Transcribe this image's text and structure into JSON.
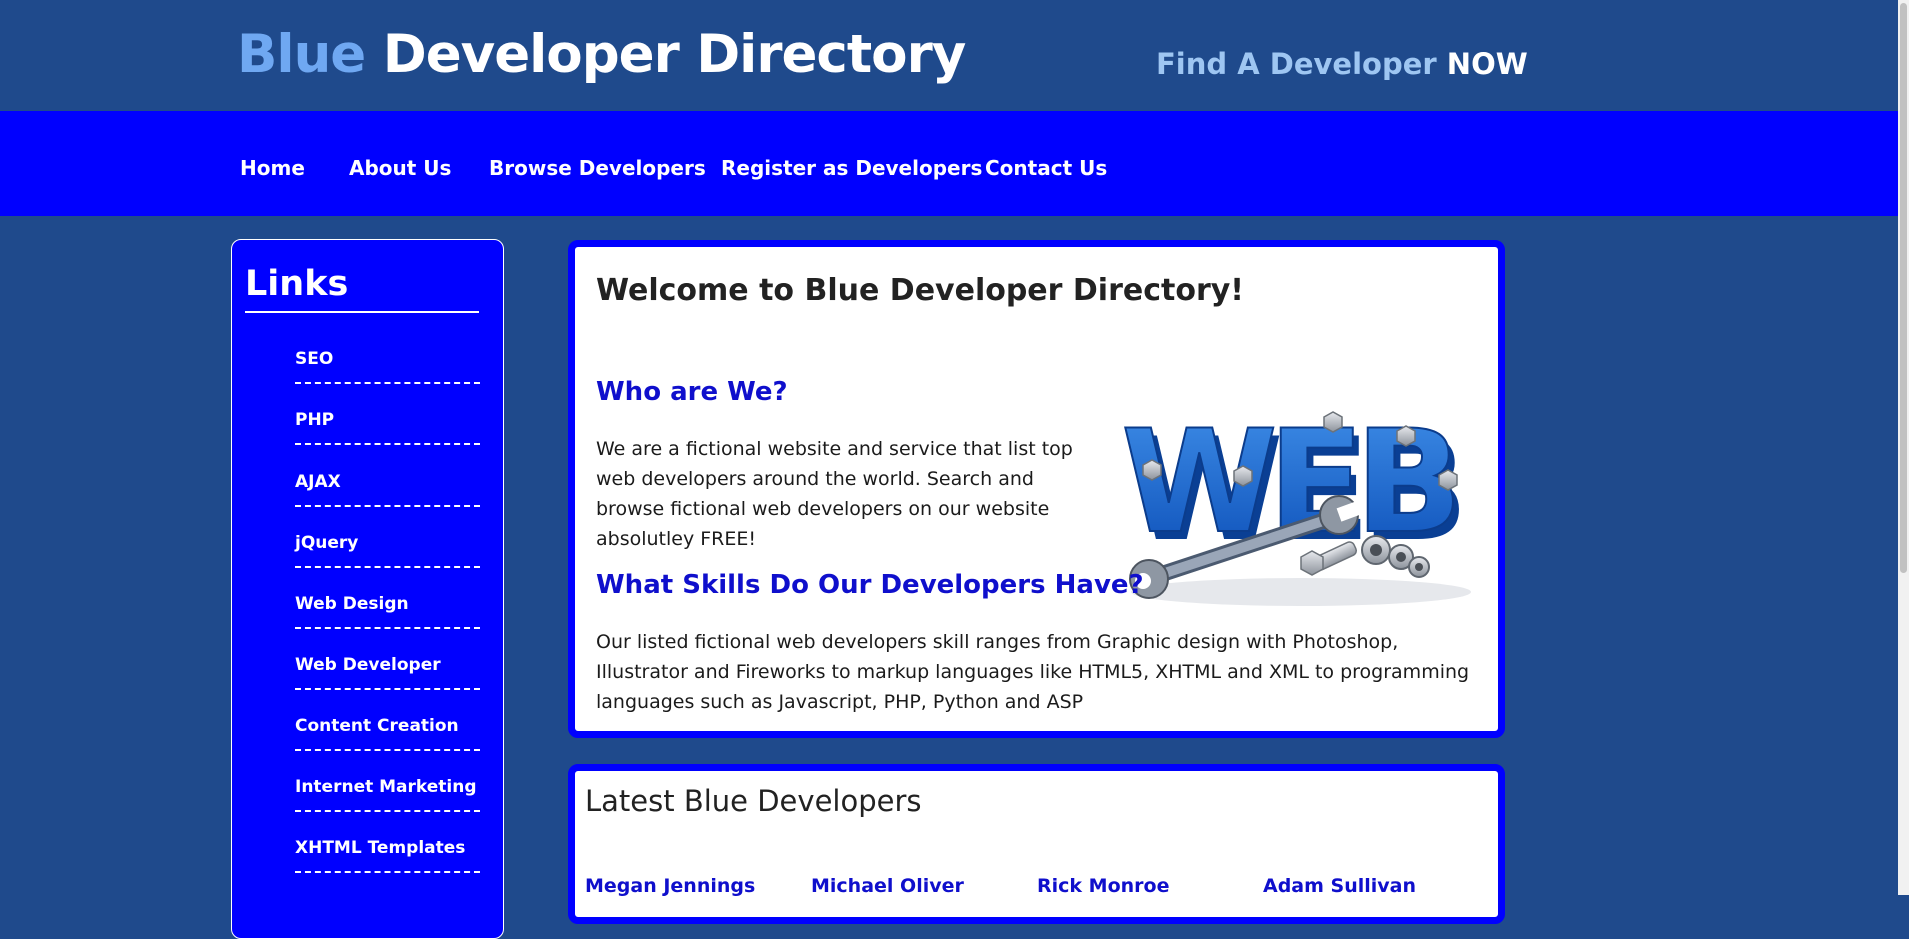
{
  "header": {
    "title_accent": "Blue",
    "title_rest": " Developer Directory",
    "tagline_main": "Find A Developer ",
    "tagline_strong": "NOW"
  },
  "nav": {
    "items": [
      {
        "label": "Home"
      },
      {
        "label": "About Us"
      },
      {
        "label": "Browse Developers"
      },
      {
        "label": "Register as Developers"
      },
      {
        "label": "Contact Us"
      }
    ]
  },
  "sidebar": {
    "title": "Links",
    "links": [
      {
        "label": "SEO"
      },
      {
        "label": "PHP"
      },
      {
        "label": "AJAX"
      },
      {
        "label": "jQuery"
      },
      {
        "label": "Web Design"
      },
      {
        "label": "Web Developer"
      },
      {
        "label": "Content Creation"
      },
      {
        "label": "Internet Marketing"
      },
      {
        "label": "XHTML Templates"
      }
    ]
  },
  "main": {
    "welcome_title": "Welcome to Blue Developer Directory!",
    "who_heading": "Who are We?",
    "who_text": "We are a fictional website and service that list top web developers around the world. Search and browse fictional web developers on our website absolutley FREE!",
    "skills_heading": "What Skills Do Our Developers Have?",
    "skills_text": "Our listed fictional web developers skill ranges from Graphic design with Photoshop, Illustrator and Fireworks to markup languages like HTML5, XHTML and XML to programming languages such as Javascript, PHP, Python and ASP",
    "graphic_text": "WEB"
  },
  "latest": {
    "title": "Latest Blue Developers",
    "developers": [
      {
        "name": "Megan Jennings"
      },
      {
        "name": "Michael Oliver"
      },
      {
        "name": "Rick Monroe"
      },
      {
        "name": "Adam Sullivan"
      }
    ]
  },
  "colors": {
    "page_background": "#1f4a8c",
    "nav_background": "#0000ff",
    "title_accent": "#6fa8f2",
    "heading_blue": "#0f0fcc"
  }
}
